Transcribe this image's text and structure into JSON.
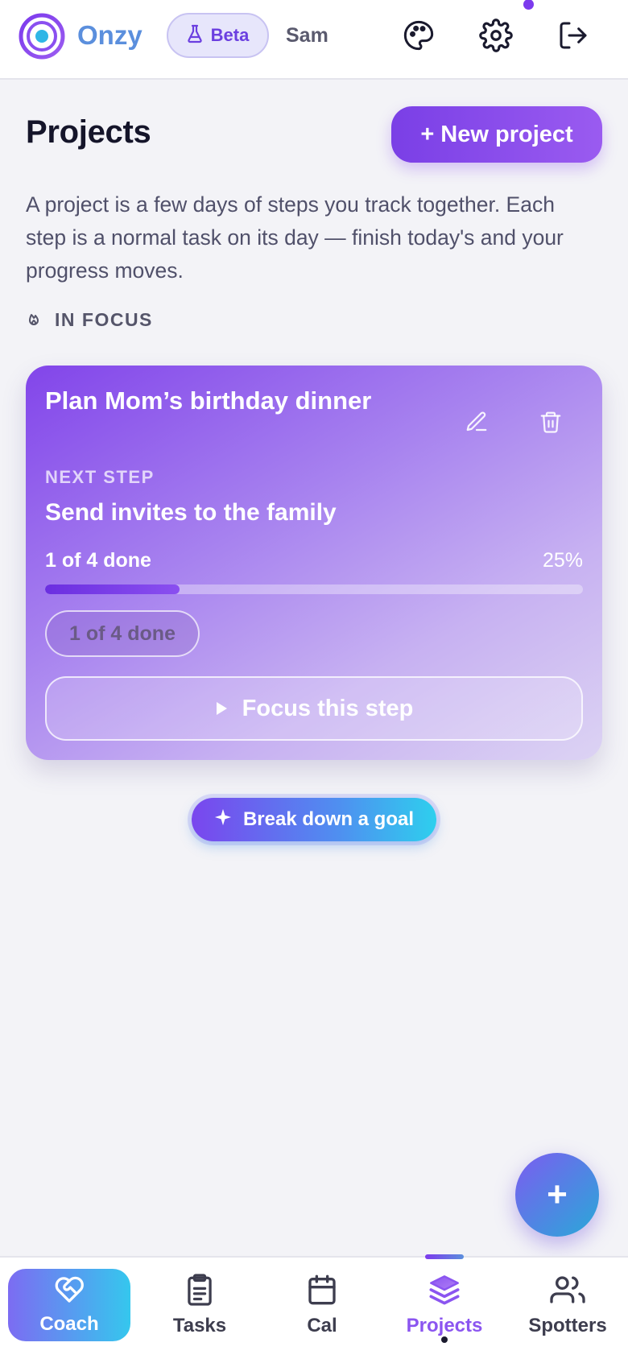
{
  "header": {
    "brand": "Onzy",
    "beta_label": "Beta",
    "user_name": "Sam",
    "icons": [
      "palette-icon",
      "gear-icon",
      "logout-icon"
    ]
  },
  "page": {
    "title": "Projects",
    "new_project_label": "+ New project",
    "intro": "A project is a few days of steps you track together. Each step is a normal task on its day — finish today's and your progress moves.",
    "focus_section_label": "IN FOCUS"
  },
  "project_card": {
    "title": "Plan Mom’s birthday dinner",
    "next_step_label": "NEXT STEP",
    "next_step_title": "Send invites to the family",
    "progress_text": "1 of 4 done",
    "progress_percent_label": "25%",
    "progress_fraction": 0.25,
    "chip_label": "1 of 4 done",
    "focus_button_label": "Focus this step"
  },
  "breakdown_button_label": "Break down a goal",
  "fab_label": "+",
  "bottom_nav": {
    "items": [
      {
        "label": "Coach",
        "icon": "heart-handshake-icon"
      },
      {
        "label": "Tasks",
        "icon": "clipboard-icon"
      },
      {
        "label": "Cal",
        "icon": "calendar-icon"
      },
      {
        "label": "Projects",
        "icon": "layers-icon"
      },
      {
        "label": "Spotters",
        "icon": "users-icon"
      }
    ],
    "active": "Projects"
  },
  "colors": {
    "accent": "#7c3aed",
    "brand_text": "#5b8fdd",
    "background": "#f3f3f7"
  }
}
